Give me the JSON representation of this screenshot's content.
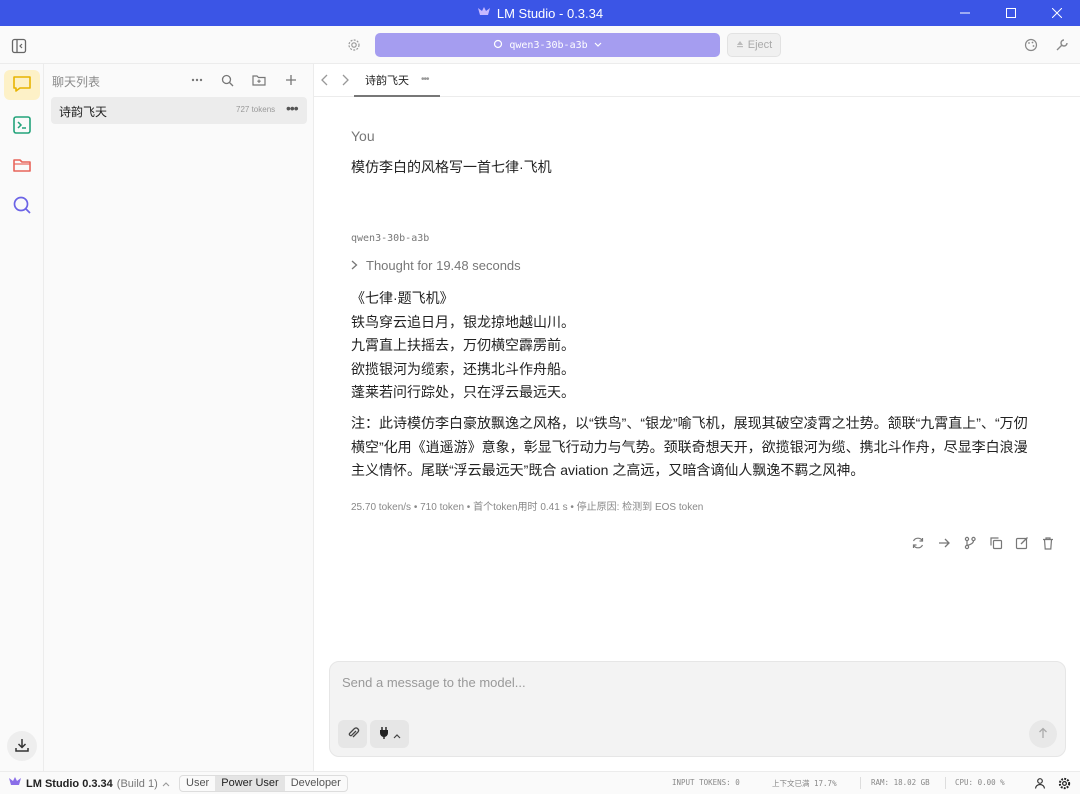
{
  "window": {
    "title": "LM Studio - 0.3.34",
    "minimize_icon": "minimize-icon",
    "maximize_icon": "maximize-icon",
    "close_icon": "close-icon"
  },
  "toolbar": {
    "model_name": "qwen3-30b-a3b",
    "eject_label": "Eject"
  },
  "sidebar": {
    "title": "聊天列表",
    "chats": [
      {
        "name": "诗韵飞天",
        "tokens": "727 tokens"
      }
    ]
  },
  "tab": {
    "label": "诗韵飞天"
  },
  "conversation": {
    "user_label": "You",
    "user_message": "模仿李白的风格写一首七律·飞机",
    "model_label": "qwen3-30b-a3b",
    "thought_label": "Thought for 19.48 seconds",
    "poem_lines": [
      "《七律·题飞机》",
      "铁鸟穿云追日月，银龙掠地越山川。",
      "九霄直上扶摇去，万仞横空霹雳前。",
      "欲揽银河为缆索，还携北斗作舟船。",
      "蓬莱若问行踪处，只在浮云最远天。"
    ],
    "note": "注：此诗模仿李白豪放飘逸之风格，以“铁鸟”、“银龙”喻飞机，展现其破空凌霄之壮势。颔联“九霄直上”、“万仞横空”化用《逍遥游》意象，彰显飞行动力与气势。颈联奇想天开，欲揽银河为缆、携北斗作舟，尽显李白浪漫主义情怀。尾联“浮云最远天”既合 aviation 之高远，又暗含谪仙人飘逸不羁之风神。",
    "stats": "25.70 token/s • 710 token • 首个token用时 0.41 s • 停止原因: 检测到 EOS token"
  },
  "composer": {
    "placeholder": "Send a message to the model..."
  },
  "statusbar": {
    "app_name": "LM Studio 0.3.34",
    "build": "(Build 1)",
    "modes": [
      "User",
      "Power User",
      "Developer"
    ],
    "active_mode": "Power User",
    "input_tokens": "INPUT TOKENS: 0",
    "context": "上下文已满 17.7%",
    "ram": "RAM: 18.02 GB",
    "cpu": "CPU: 0.00 %"
  },
  "colors": {
    "titlebar": "#3b55e6",
    "model_pill": "#a59df0",
    "chat_icon": "#e8b400",
    "terminal_icon": "#22a37a",
    "folder_icon": "#e8645a",
    "search_icon": "#6b63e6"
  }
}
